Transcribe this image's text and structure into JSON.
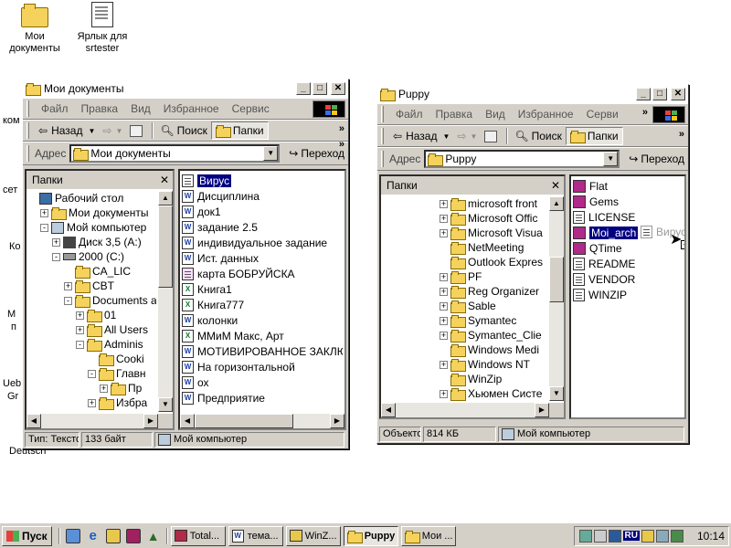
{
  "desktop": {
    "icons": [
      {
        "name": "Мои документы",
        "line2": "документы",
        "line1": "Мои"
      },
      {
        "name": "Ярлык для srtester",
        "line1": "Ярлык для",
        "line2": "srtester"
      }
    ],
    "edge_fragments": [
      "ком",
      "сет",
      "Ко",
      "М",
      "п",
      "Ueb",
      "Gr",
      "Deutsch"
    ]
  },
  "window_docs": {
    "title": "Мои документы",
    "menu": [
      "Файл",
      "Правка",
      "Вид",
      "Избранное",
      "Сервис"
    ],
    "back_label": "Назад",
    "search_label": "Поиск",
    "folders_label": "Папки",
    "address_label": "Адрес",
    "address_value": "Мои документы",
    "go_label": "Переход",
    "pane_title": "Папки",
    "tree": [
      {
        "label": "Рабочий стол",
        "indent": 0,
        "pm": "",
        "icon": "desktop-icon"
      },
      {
        "label": "Мои документы",
        "indent": 1,
        "pm": "+",
        "icon": "folder-icon"
      },
      {
        "label": "Мой компьютер",
        "indent": 1,
        "pm": "-",
        "icon": "computer-icon"
      },
      {
        "label": "Диск 3,5 (A:)",
        "indent": 2,
        "pm": "+",
        "icon": "floppy-icon"
      },
      {
        "label": "2000 (C:)",
        "indent": 2,
        "pm": "-",
        "icon": "drive-icon"
      },
      {
        "label": "CA_LIC",
        "indent": 3,
        "pm": "",
        "icon": "folder-icon"
      },
      {
        "label": "CBT",
        "indent": 3,
        "pm": "+",
        "icon": "folder-icon"
      },
      {
        "label": "Documents a",
        "indent": 3,
        "pm": "-",
        "icon": "folder-icon"
      },
      {
        "label": "01",
        "indent": 4,
        "pm": "+",
        "icon": "folder-icon"
      },
      {
        "label": "All Users",
        "indent": 4,
        "pm": "+",
        "icon": "folder-icon"
      },
      {
        "label": "Adminis",
        "indent": 4,
        "pm": "-",
        "icon": "folder-icon"
      },
      {
        "label": "Cooki",
        "indent": 5,
        "pm": "",
        "icon": "folder-icon"
      },
      {
        "label": "Главн",
        "indent": 5,
        "pm": "-",
        "icon": "folder-icon"
      },
      {
        "label": "Пр",
        "indent": 6,
        "pm": "+",
        "icon": "folder-icon"
      },
      {
        "label": "Избра",
        "indent": 5,
        "pm": "+",
        "icon": "folder-icon"
      }
    ],
    "files": [
      {
        "label": "Вирус",
        "type": "text",
        "selected": true
      },
      {
        "label": "Дисциплина",
        "type": "word"
      },
      {
        "label": "док1",
        "type": "word"
      },
      {
        "label": "задание 2.5",
        "type": "word"
      },
      {
        "label": "индивидуальное задание",
        "type": "word"
      },
      {
        "label": "Ист. данных",
        "type": "word"
      },
      {
        "label": "карта БОБРУЙСКА",
        "type": "pic"
      },
      {
        "label": "Книга1",
        "type": "excel"
      },
      {
        "label": "Книга777",
        "type": "excel"
      },
      {
        "label": "колонки",
        "type": "word"
      },
      {
        "label": "ММиМ Макс, Арт",
        "type": "excel"
      },
      {
        "label": "МОТИВИРОВАННОЕ ЗАКЛЮ",
        "type": "word"
      },
      {
        "label": "На горизонтальной",
        "type": "word"
      },
      {
        "label": "ох",
        "type": "word"
      },
      {
        "label": "Предприятие",
        "type": "word"
      }
    ],
    "status": {
      "type": "Тип: Текстов",
      "size": "133 байт",
      "location": "Мой компьютер"
    }
  },
  "window_puppy": {
    "title": "Puppy",
    "menu": [
      "Файл",
      "Правка",
      "Вид",
      "Избранное",
      "Серви"
    ],
    "back_label": "Назад",
    "search_label": "Поиск",
    "folders_label": "Папки",
    "address_label": "Адрес",
    "address_value": "Puppy",
    "go_label": "Переход",
    "pane_title": "Папки",
    "tree": [
      {
        "label": "microsoft front",
        "pm": "+"
      },
      {
        "label": "Microsoft Offic",
        "pm": "+"
      },
      {
        "label": "Microsoft Visua",
        "pm": "+"
      },
      {
        "label": "NetMeeting",
        "pm": ""
      },
      {
        "label": "Outlook Expres",
        "pm": ""
      },
      {
        "label": "PF",
        "pm": "+"
      },
      {
        "label": "Reg Organizer",
        "pm": "+"
      },
      {
        "label": "Sable",
        "pm": "+"
      },
      {
        "label": "Symantec",
        "pm": "+"
      },
      {
        "label": "Symantec_Clie",
        "pm": "+"
      },
      {
        "label": "Windows Medi",
        "pm": ""
      },
      {
        "label": "Windows NT",
        "pm": "+"
      },
      {
        "label": "WinZip",
        "pm": ""
      },
      {
        "label": "Хьюмен Систе",
        "pm": "+"
      }
    ],
    "files": [
      {
        "label": "Flat",
        "type": "rar"
      },
      {
        "label": "Gems",
        "type": "rar"
      },
      {
        "label": "LICENSE",
        "type": "text"
      },
      {
        "label": "Moi_arch",
        "type": "rar",
        "selected": true
      },
      {
        "label": "QTime",
        "type": "rar"
      },
      {
        "label": "README",
        "type": "text"
      },
      {
        "label": "VENDOR",
        "type": "text"
      },
      {
        "label": "WINZIP",
        "type": "text"
      }
    ],
    "drag_ghost": "Вирус",
    "status": {
      "objects": "Объекто",
      "size": "814 КБ",
      "location": "Мой компьютер"
    }
  },
  "taskbar": {
    "start": "Пуск",
    "tasks": [
      {
        "label": "Total...",
        "active": false
      },
      {
        "label": "тема...",
        "active": false
      },
      {
        "label": "WinZ...",
        "active": false
      },
      {
        "label": "Puppy",
        "active": true
      },
      {
        "label": "Мои ...",
        "active": false
      }
    ],
    "lang": "RU",
    "clock": "10:14"
  }
}
